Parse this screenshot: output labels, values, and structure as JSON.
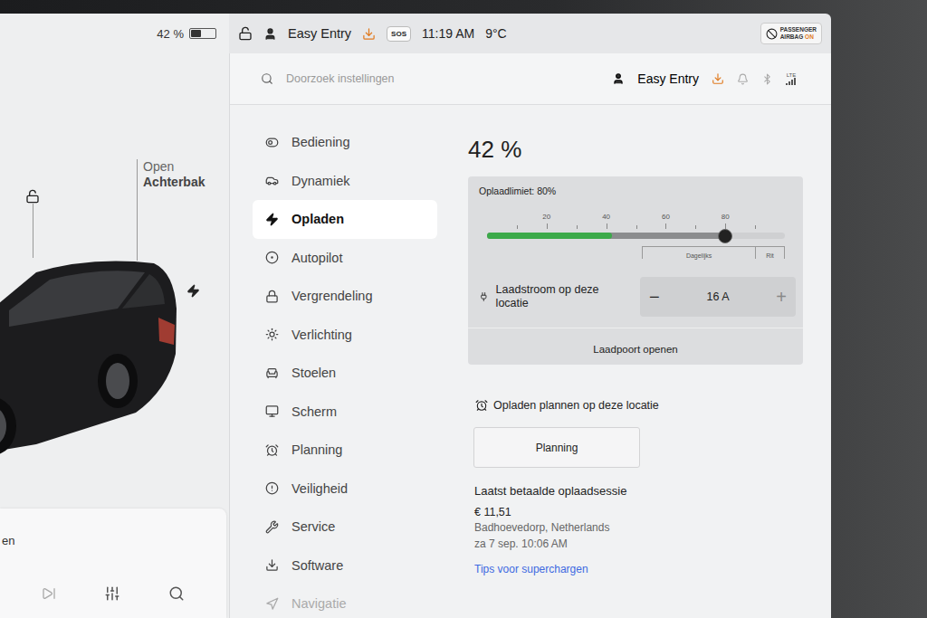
{
  "status_bar": {
    "battery": "42 %",
    "battery_level": 0.42,
    "locked": false,
    "profile": "Easy Entry",
    "sos": "SOS",
    "time": "11:19 AM",
    "temperature": "9°C",
    "airbag": {
      "line1": "PASSENGER",
      "line2": "AIRBAG",
      "state": "ON"
    }
  },
  "car_view": {
    "trunk_action": "Open",
    "trunk_label": "Achterbak",
    "locked": false,
    "charging": true
  },
  "media": {
    "title": "en"
  },
  "settings_header": {
    "search_placeholder": "Doorzoek instellingen",
    "profile": "Easy Entry",
    "network": "LTE"
  },
  "sidebar": {
    "items": [
      {
        "label": "Bediening",
        "selected": false,
        "faded": false
      },
      {
        "label": "Dynamiek",
        "selected": false,
        "faded": false
      },
      {
        "label": "Opladen",
        "selected": true,
        "faded": false
      },
      {
        "label": "Autopilot",
        "selected": false,
        "faded": false
      },
      {
        "label": "Vergrendeling",
        "selected": false,
        "faded": false
      },
      {
        "label": "Verlichting",
        "selected": false,
        "faded": false
      },
      {
        "label": "Stoelen",
        "selected": false,
        "faded": false
      },
      {
        "label": "Scherm",
        "selected": false,
        "faded": false
      },
      {
        "label": "Planning",
        "selected": false,
        "faded": false
      },
      {
        "label": "Veiligheid",
        "selected": false,
        "faded": false
      },
      {
        "label": "Service",
        "selected": false,
        "faded": false
      },
      {
        "label": "Software",
        "selected": false,
        "faded": false
      },
      {
        "label": "Navigatie",
        "selected": false,
        "faded": true
      }
    ]
  },
  "charging": {
    "percent": "42 %",
    "limit_label": "Oplaadlimiet: 80%",
    "battery_level": 0.42,
    "limit_level": 0.8,
    "ticks": [
      "20",
      "40",
      "60",
      "80"
    ],
    "ranges": [
      "Dagelijks",
      "Rit"
    ],
    "current_label": "Laadstroom op deze locatie",
    "current_value": "16 A",
    "decrease": "−",
    "increase": "+",
    "port_button": "Laadpoort openen"
  },
  "schedule": {
    "title": "Opladen plannen op deze locatie",
    "button": "Planning"
  },
  "last_session": {
    "title": "Laatst betaalde oplaadsessie",
    "amount": "€ 11,51",
    "location": "Badhoevedorp, Netherlands",
    "date": "za 7 sep. 10:06 AM",
    "link": "Tips voor superchargen"
  }
}
